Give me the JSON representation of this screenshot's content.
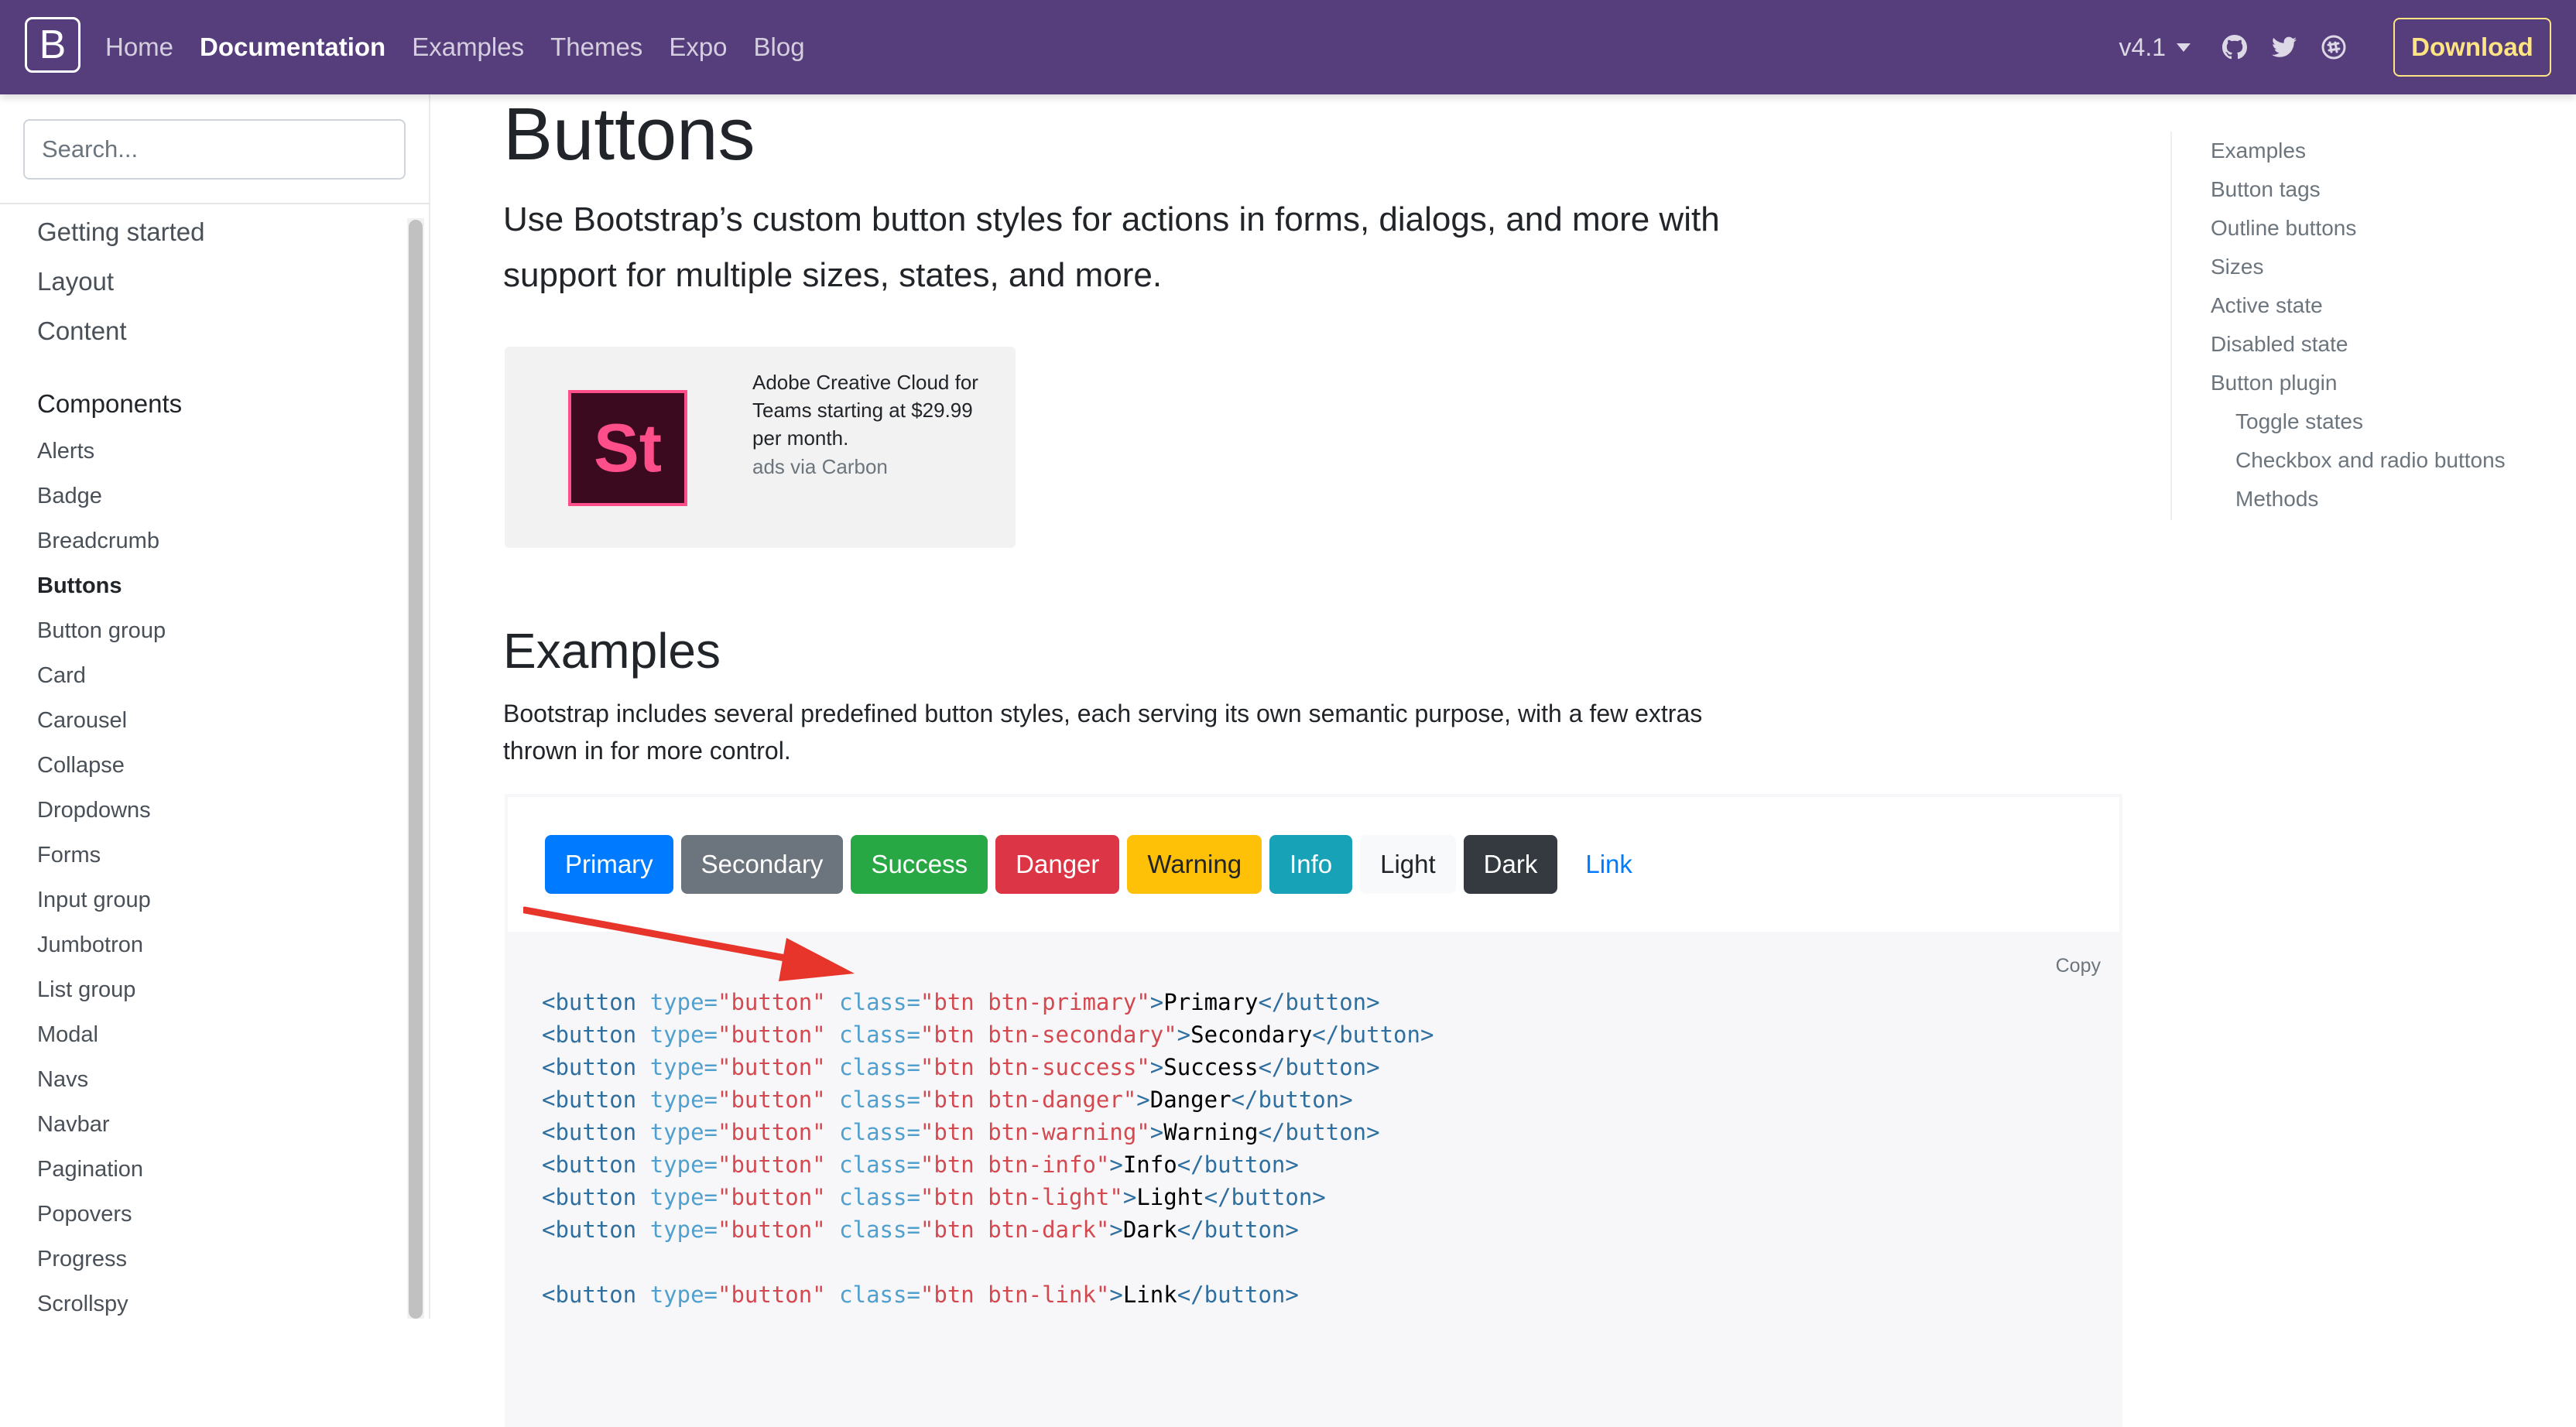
{
  "navbar": {
    "brand": "B",
    "links": [
      {
        "label": "Home",
        "active": false
      },
      {
        "label": "Documentation",
        "active": true
      },
      {
        "label": "Examples",
        "active": false
      },
      {
        "label": "Themes",
        "active": false
      },
      {
        "label": "Expo",
        "active": false
      },
      {
        "label": "Blog",
        "active": false
      }
    ],
    "version": "v4.1",
    "icons": [
      "github-icon",
      "twitter-icon",
      "slack-icon"
    ],
    "download_label": "Download",
    "background": "#563d7c",
    "accent": "#ffe484"
  },
  "sidebar": {
    "search_placeholder": "Search...",
    "top_items": [
      "Getting started",
      "Layout",
      "Content"
    ],
    "group_title": "Components",
    "items": [
      {
        "label": "Alerts",
        "active": false
      },
      {
        "label": "Badge",
        "active": false
      },
      {
        "label": "Breadcrumb",
        "active": false
      },
      {
        "label": "Buttons",
        "active": true
      },
      {
        "label": "Button group",
        "active": false
      },
      {
        "label": "Card",
        "active": false
      },
      {
        "label": "Carousel",
        "active": false
      },
      {
        "label": "Collapse",
        "active": false
      },
      {
        "label": "Dropdowns",
        "active": false
      },
      {
        "label": "Forms",
        "active": false
      },
      {
        "label": "Input group",
        "active": false
      },
      {
        "label": "Jumbotron",
        "active": false
      },
      {
        "label": "List group",
        "active": false
      },
      {
        "label": "Modal",
        "active": false
      },
      {
        "label": "Navs",
        "active": false
      },
      {
        "label": "Navbar",
        "active": false
      },
      {
        "label": "Pagination",
        "active": false
      },
      {
        "label": "Popovers",
        "active": false
      },
      {
        "label": "Progress",
        "active": false
      },
      {
        "label": "Scrollspy",
        "active": false
      }
    ]
  },
  "main": {
    "title": "Buttons",
    "lead": "Use Bootstrap’s custom button styles for actions in forms, dialogs, and more with support for multiple sizes, states, and more.",
    "ad": {
      "logo_text": "St",
      "text": "Adobe Creative Cloud for Teams starting at $29.99 per month.",
      "powered_by": "ads via Carbon"
    },
    "examples_title": "Examples",
    "examples_desc": "Bootstrap includes several predefined button styles, each serving its own semantic purpose, with a few extras thrown in for more control.",
    "buttons": [
      {
        "label": "Primary",
        "variant": "primary"
      },
      {
        "label": "Secondary",
        "variant": "secondary"
      },
      {
        "label": "Success",
        "variant": "success"
      },
      {
        "label": "Danger",
        "variant": "danger"
      },
      {
        "label": "Warning",
        "variant": "warning"
      },
      {
        "label": "Info",
        "variant": "info"
      },
      {
        "label": "Light",
        "variant": "light"
      },
      {
        "label": "Dark",
        "variant": "dark"
      },
      {
        "label": "Link",
        "variant": "link"
      }
    ],
    "copy_label": "Copy",
    "code_lines": [
      {
        "cls": "btn btn-primary",
        "text": "Primary"
      },
      {
        "cls": "btn btn-secondary",
        "text": "Secondary"
      },
      {
        "cls": "btn btn-success",
        "text": "Success"
      },
      {
        "cls": "btn btn-danger",
        "text": "Danger"
      },
      {
        "cls": "btn btn-warning",
        "text": "Warning"
      },
      {
        "cls": "btn btn-info",
        "text": "Info"
      },
      {
        "cls": "btn btn-light",
        "text": "Light"
      },
      {
        "cls": "btn btn-dark",
        "text": "Dark"
      },
      null,
      {
        "cls": "btn btn-link",
        "text": "Link"
      }
    ]
  },
  "toc": {
    "items": [
      {
        "label": "Examples",
        "sub": false
      },
      {
        "label": "Button tags",
        "sub": false
      },
      {
        "label": "Outline buttons",
        "sub": false
      },
      {
        "label": "Sizes",
        "sub": false
      },
      {
        "label": "Active state",
        "sub": false
      },
      {
        "label": "Disabled state",
        "sub": false
      },
      {
        "label": "Button plugin",
        "sub": false
      },
      {
        "label": "Toggle states",
        "sub": true
      },
      {
        "label": "Checkbox and radio buttons",
        "sub": true
      },
      {
        "label": "Methods",
        "sub": true
      }
    ]
  },
  "annotation_arrow_color": "#e8352b"
}
